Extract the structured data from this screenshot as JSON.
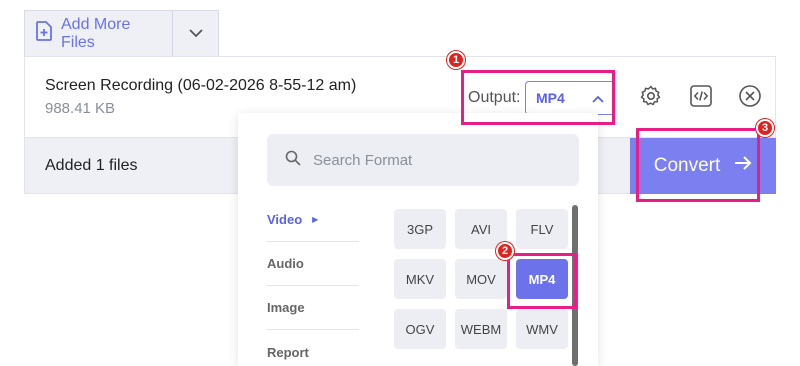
{
  "toolbar": {
    "add_files_label": "Add More Files"
  },
  "file": {
    "name": "Screen Recording (06-02-2026 8-55-12 am)",
    "size": "988.41 KB"
  },
  "output": {
    "label": "Output:",
    "value": "MP4"
  },
  "footer": {
    "added_label": "Added 1 files",
    "convert_label": "Convert"
  },
  "format_panel": {
    "search_placeholder": "Search Format",
    "categories": [
      {
        "label": "Video"
      },
      {
        "label": "Audio"
      },
      {
        "label": "Image"
      },
      {
        "label": "Report"
      }
    ],
    "formats": [
      "3GP",
      "AVI",
      "FLV",
      "MKV",
      "MOV",
      "MP4",
      "OGV",
      "WEBM",
      "WMV"
    ],
    "selected": "MP4"
  },
  "annotations": {
    "badges": [
      "1",
      "2",
      "3"
    ],
    "color": "#e81d86",
    "badge_color": "#e0231e"
  },
  "colors": {
    "accent": "#6b72e8",
    "convert_bg": "#7b7ff0"
  },
  "icons": [
    "add-file-icon",
    "chevron-down-icon",
    "chevron-up-icon",
    "gear-icon",
    "code-icon",
    "close-circle-icon",
    "arrow-right-icon",
    "search-icon",
    "caret-right-icon"
  ]
}
